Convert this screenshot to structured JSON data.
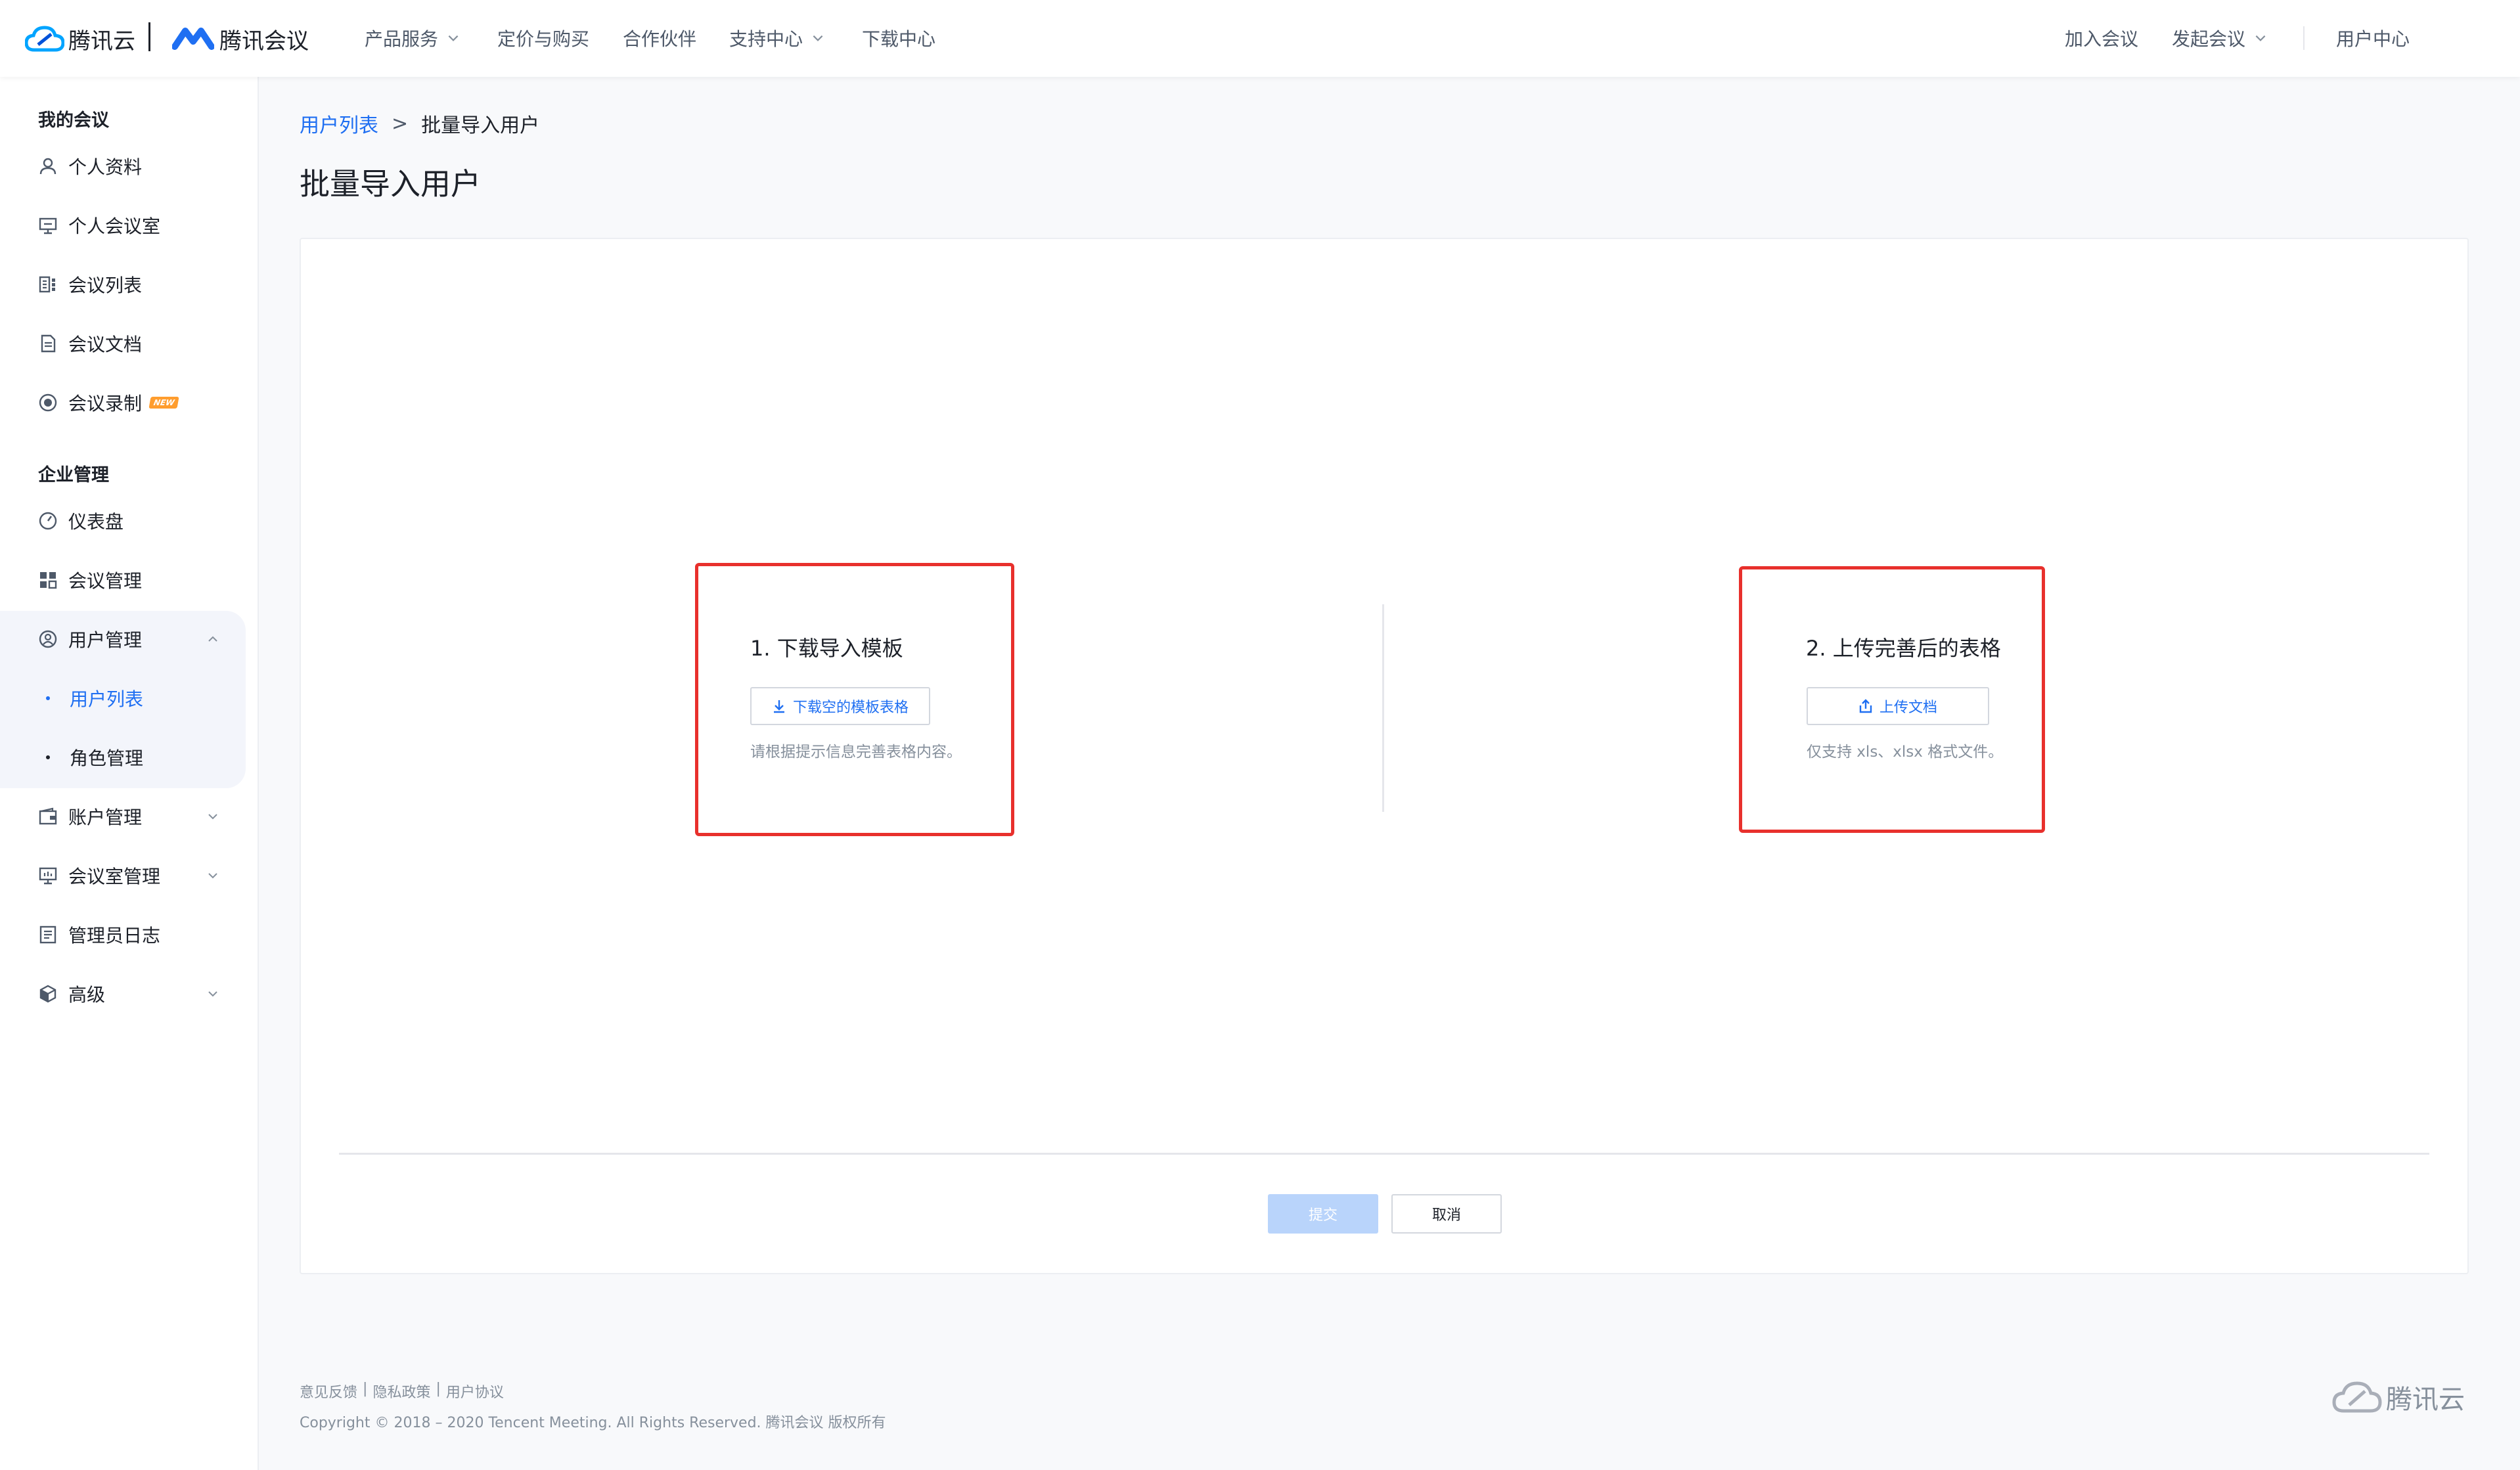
{
  "header": {
    "brand_tencent_cloud": "腾讯云",
    "brand_tencent_meeting": "腾讯会议",
    "nav": [
      {
        "label": "产品服务"
      },
      {
        "label": "定价与购买"
      },
      {
        "label": "合作伙伴"
      },
      {
        "label": "支持中心"
      },
      {
        "label": "下载中心"
      }
    ],
    "right": {
      "join": "加入会议",
      "start": "发起会议",
      "user_center": "用户中心"
    }
  },
  "sidebar": {
    "section_my": "我的会议",
    "my_items": [
      {
        "label": "个人资料",
        "icon": "user-icon"
      },
      {
        "label": "个人会议室",
        "icon": "meeting-room-icon"
      },
      {
        "label": "会议列表",
        "icon": "list-icon"
      },
      {
        "label": "会议文档",
        "icon": "document-icon"
      },
      {
        "label": "会议录制",
        "icon": "record-icon",
        "badge": "NEW"
      }
    ],
    "section_enterprise": "企业管理",
    "enterprise_items": [
      {
        "label": "仪表盘",
        "icon": "dashboard-icon"
      },
      {
        "label": "会议管理",
        "icon": "grid-icon"
      },
      {
        "label": "用户管理",
        "icon": "user-manage-icon"
      },
      {
        "label": "账户管理",
        "icon": "wallet-icon"
      },
      {
        "label": "会议室管理",
        "icon": "room-manage-icon"
      },
      {
        "label": "管理员日志",
        "icon": "log-icon"
      },
      {
        "label": "高级",
        "icon": "advanced-icon"
      }
    ],
    "user_sub_items": [
      {
        "label": "用户列表",
        "active": true
      },
      {
        "label": "角色管理",
        "active": false
      }
    ]
  },
  "main": {
    "breadcrumb": {
      "parent": "用户列表",
      "separator": ">",
      "current": "批量导入用户"
    },
    "title": "批量导入用户",
    "step1": {
      "title": "1. 下载导入模板",
      "button": "下载空的模板表格",
      "hint": "请根据提示信息完善表格内容。"
    },
    "step2": {
      "title": "2. 上传完善后的表格",
      "button": "上传文档",
      "hint": "仅支持 xls、xlsx 格式文件。"
    },
    "submit": "提交",
    "cancel": "取消"
  },
  "footer": {
    "links": [
      "意见反馈",
      "隐私政策",
      "用户协议"
    ],
    "separator": "|",
    "copyright": "Copyright © 2018 – 2020 Tencent Meeting. All Rights Reserved. 腾讯会议 版权所有",
    "logo_text": "腾讯云"
  },
  "colors": {
    "accent": "#1f6ff2",
    "highlight_box": "#e8302c",
    "submit_disabled": "#b9d4fb",
    "new_badge": "#ff9d2e"
  }
}
